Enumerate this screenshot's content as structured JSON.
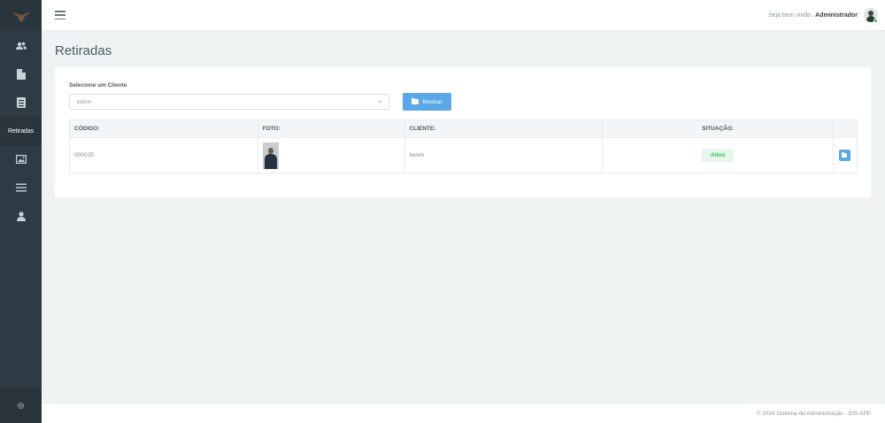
{
  "sidebar": {
    "logo": "bull-logo-icon",
    "items": [
      {
        "icon": "users-icon",
        "label": ""
      },
      {
        "icon": "file-icon",
        "label": ""
      },
      {
        "icon": "book-icon",
        "label": ""
      },
      {
        "icon": "",
        "label": "Retiradas"
      },
      {
        "icon": "image-icon",
        "label": ""
      },
      {
        "icon": "list-icon",
        "label": ""
      },
      {
        "icon": "user-icon",
        "label": ""
      }
    ],
    "bottom_icon": "gear-icon"
  },
  "topbar": {
    "welcome_text": "Seja bem vindo,",
    "user_name": "Administrador"
  },
  "page": {
    "title": "Retiradas"
  },
  "filter": {
    "label": "Selecione um Cliente",
    "selected": "kelvin",
    "button_label": "Mostrar"
  },
  "table": {
    "headers": [
      "CÓDIGO:",
      "FOTO:",
      "CLIENTE:",
      "SITUAÇÃO:",
      ""
    ],
    "rows": [
      {
        "codigo": "000025",
        "cliente": "kelvin",
        "situacao": "Ativo"
      }
    ]
  },
  "footer": {
    "text": "© 2024 Sistema de Administração - OXI APP"
  },
  "colors": {
    "sidebar_bg": "#2e3a44",
    "accent": "#5aa9e6",
    "status_active": "#27c24c"
  }
}
